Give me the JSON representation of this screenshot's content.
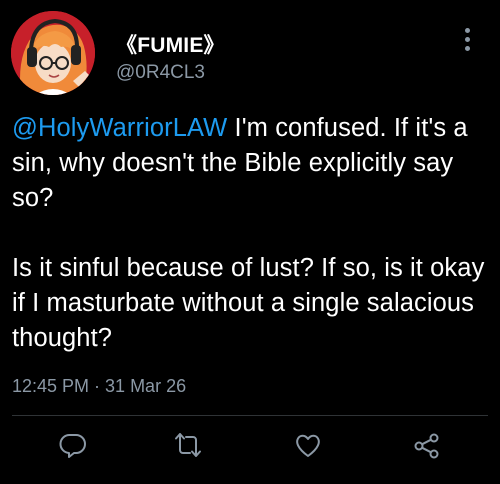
{
  "author": {
    "display_name": "《FUMIE》",
    "handle": "@0R4CL3"
  },
  "tweet": {
    "mention": "@HolyWarriorLAW",
    "paragraph1": " I'm confused. If it's a sin, why doesn't the Bible explicitly say so?",
    "paragraph2": "Is it sinful because of lust? If so, is it okay if I masturbate without a single salacious thought?",
    "timestamp": "12:45 PM · 31 Mar 26"
  },
  "icons": {
    "more": "more-vertical-icon",
    "reply": "reply-icon",
    "retweet": "retweet-icon",
    "like": "heart-icon",
    "share": "share-icon"
  },
  "colors": {
    "background": "#000000",
    "text": "#ffffff",
    "secondary": "#8b98a5",
    "link": "#1d9bf0",
    "avatar_bg": "#c7202a"
  }
}
